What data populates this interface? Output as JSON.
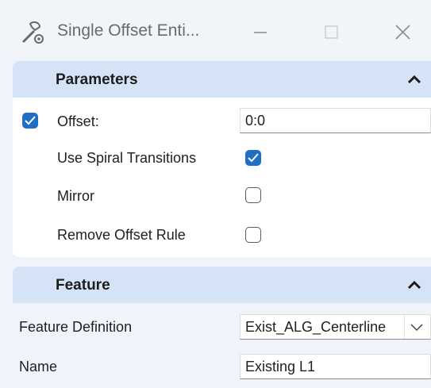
{
  "window": {
    "title": "Single Offset Enti...",
    "icons": {
      "app": "wrench-settings-icon",
      "minimize": "minimize-icon",
      "maximize": "maximize-icon",
      "close": "close-icon"
    }
  },
  "parameters": {
    "header": "Parameters",
    "offset": {
      "label": "Offset:",
      "checked": true,
      "value": "0:0"
    },
    "use_spiral": {
      "label": "Use Spiral Transitions",
      "checked": true
    },
    "mirror": {
      "label": "Mirror",
      "checked": false
    },
    "remove_rule": {
      "label": "Remove Offset Rule",
      "checked": false
    }
  },
  "feature": {
    "header": "Feature",
    "definition": {
      "label": "Feature Definition",
      "value": "Exist_ALG_Centerline"
    },
    "name": {
      "label": "Name",
      "value": "Existing L1"
    }
  },
  "colors": {
    "accent": "#1f6fc5",
    "header_bg": "#d5e3f6",
    "window_bg": "#f0f4fa"
  }
}
